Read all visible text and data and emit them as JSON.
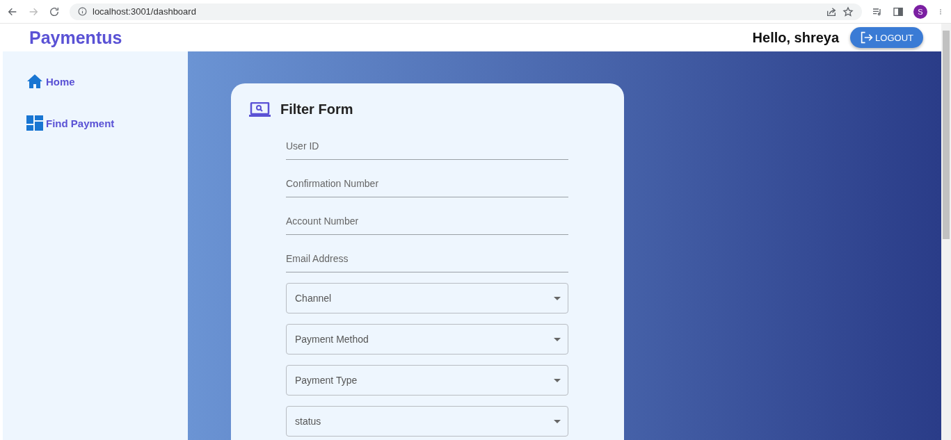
{
  "browser": {
    "url": "localhost:3001/dashboard",
    "profile_initial": "S"
  },
  "header": {
    "brand": "Paymentus",
    "greeting": "Hello, shreya",
    "logout": "LOGOUT"
  },
  "sidebar": {
    "items": [
      {
        "label": "Home"
      },
      {
        "label": "Find Payment"
      }
    ]
  },
  "form": {
    "title": "Filter Form",
    "fields": [
      {
        "kind": "text",
        "placeholder": "User ID"
      },
      {
        "kind": "text",
        "placeholder": "Confirmation Number"
      },
      {
        "kind": "text",
        "placeholder": "Account Number"
      },
      {
        "kind": "text",
        "placeholder": "Email Address"
      },
      {
        "kind": "select",
        "placeholder": "Channel"
      },
      {
        "kind": "select",
        "placeholder": "Payment Method"
      },
      {
        "kind": "select",
        "placeholder": "Payment Type"
      },
      {
        "kind": "select",
        "placeholder": "status"
      }
    ]
  }
}
